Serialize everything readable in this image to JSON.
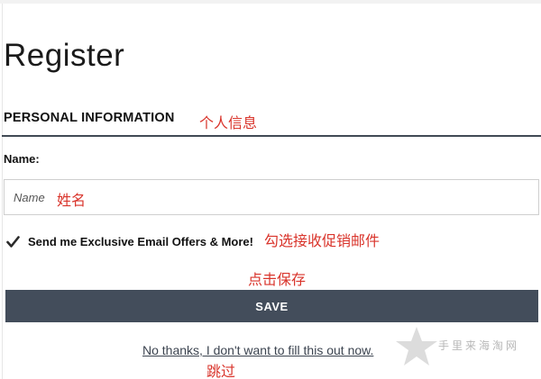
{
  "form": {
    "title": "Register",
    "section_heading": "PERSONAL INFORMATION",
    "name_label": "Name:",
    "name_placeholder": "Name",
    "name_value": "",
    "email_offers_label": "Send me Exclusive Email Offers & More!",
    "email_offers_checked": true,
    "save_label": "SAVE",
    "skip_link": "No thanks, I don't want to fill this out now."
  },
  "annotations": {
    "personal_info": "个人信息",
    "name": "姓名",
    "email_opt_in": "勾选接收促销邮件",
    "save": "点击保存",
    "skip": "跳过"
  },
  "watermark": {
    "text": "手里来海淘网"
  },
  "colors": {
    "button_bg": "#434d5b",
    "rule": "#414a55",
    "annotation": "#d9342b",
    "watermark": "#b7b7b7"
  },
  "icons": {
    "checkbox": "checkmark-icon",
    "watermark": "star-icon"
  }
}
